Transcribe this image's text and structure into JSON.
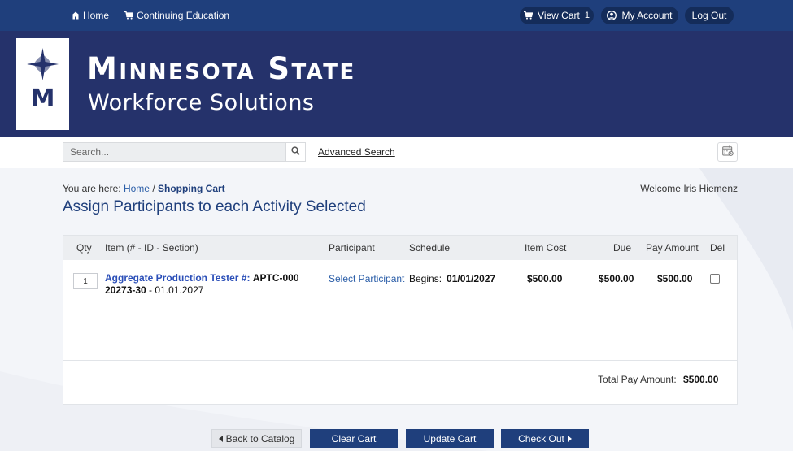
{
  "topnav": {
    "home_label": "Home",
    "ce_label": "Continuing Education",
    "view_cart_label": "View Cart",
    "cart_count": "1",
    "account_label": "My Account",
    "logout_label": "Log Out"
  },
  "banner": {
    "line1": "Minnesota State",
    "line2": "Workforce Solutions",
    "logo_letter": "M"
  },
  "search": {
    "placeholder": "Search...",
    "advanced_label": "Advanced Search"
  },
  "breadcrumb": {
    "prefix": "You are here:",
    "home": "Home",
    "separator": "/",
    "current": "Shopping Cart"
  },
  "welcome": "Welcome Iris Hiemenz",
  "page_title": "Assign Participants to each Activity Selected",
  "table": {
    "headers": {
      "qty": "Qty",
      "item": "Item (# - ID - Section)",
      "participant": "Participant",
      "schedule": "Schedule",
      "item_cost": "Item Cost",
      "due": "Due",
      "pay_amount": "Pay Amount",
      "del": "Del"
    },
    "rows": [
      {
        "qty": "1",
        "item_link": "Aggregate Production Tester #:",
        "item_code": "APTC-000 20273-30",
        "item_rest": " - 01.01.2027",
        "participant": "Select Participant",
        "schedule_label": "Begins:",
        "schedule_date": "01/01/2027",
        "item_cost": "$500.00",
        "due": "$500.00",
        "pay_amount": "$500.00"
      }
    ],
    "total_label": "Total Pay Amount:",
    "total_value": "$500.00"
  },
  "buttons": {
    "back": "Back to Catalog",
    "clear": "Clear Cart",
    "update": "Update Cart",
    "checkout": "Check Out"
  },
  "colors": {
    "nav": "#1f3f7c",
    "banner": "#25326b",
    "link": "#2b5ea8",
    "button": "#1f3f7c"
  }
}
